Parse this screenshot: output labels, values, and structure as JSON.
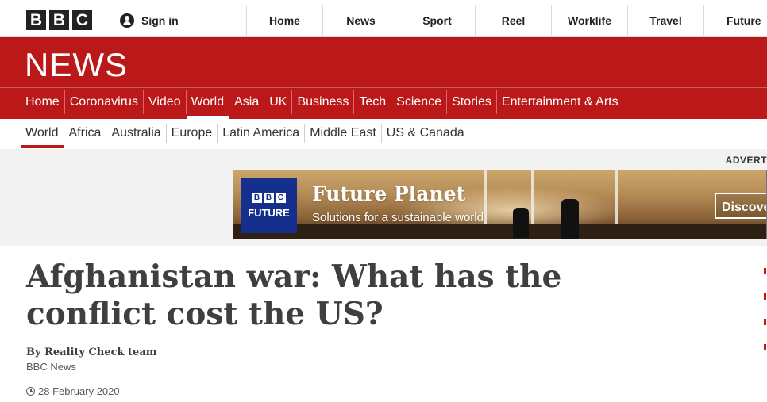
{
  "bbc_logo": [
    "B",
    "B",
    "C"
  ],
  "account": {
    "signin_label": "Sign in"
  },
  "top_nav": [
    "Home",
    "News",
    "Sport",
    "Reel",
    "Worklife",
    "Travel",
    "Future"
  ],
  "brand": {
    "title": "NEWS",
    "color": "#bb1919"
  },
  "main_nav": [
    "Home",
    "Coronavirus",
    "Video",
    "World",
    "Asia",
    "UK",
    "Business",
    "Tech",
    "Science",
    "Stories",
    "Entertainment & Arts"
  ],
  "main_nav_active": "World",
  "sub_nav": [
    "World",
    "Africa",
    "Australia",
    "Europe",
    "Latin America",
    "Middle East",
    "US & Canada"
  ],
  "sub_nav_active": "World",
  "advert": {
    "label": "ADVERT",
    "logo_letters": [
      "B",
      "B",
      "C"
    ],
    "logo_word": "FUTURE",
    "headline": "Future Planet",
    "subline": "Solutions for a sustainable world",
    "cta": "Discover"
  },
  "article": {
    "headline": "Afghanistan war: What has the conflict cost the US?",
    "byline": "By Reality Check team",
    "source": "BBC News",
    "date": "28 February 2020"
  }
}
